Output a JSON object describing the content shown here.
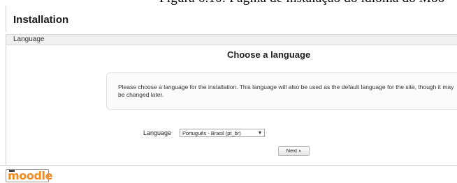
{
  "caption": "Figura 6.10: Página de instalação do idioma do Moo",
  "header": {
    "title": "Installation"
  },
  "breadcrumb": {
    "label": "Language"
  },
  "main": {
    "title": "Choose a language",
    "info_text": "Please choose a language for the installation. This language will also be used as the default language for the site, though it may be changed later.",
    "language_label": "Language",
    "language_selected": "Português - Brasil (pt_br)",
    "next_button": "Next »"
  },
  "footer": {
    "logo_text": "moodle"
  },
  "colors": {
    "logo_orange": "#f58a1f",
    "navbar_bg": "#f0f0f0",
    "border": "#cfcfcf"
  }
}
